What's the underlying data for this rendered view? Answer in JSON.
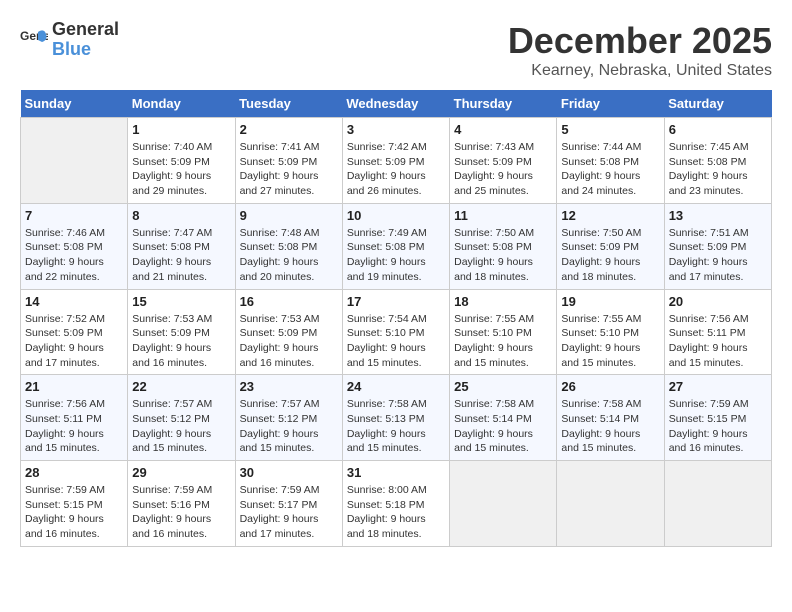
{
  "header": {
    "logo_general": "General",
    "logo_blue": "Blue",
    "month": "December 2025",
    "location": "Kearney, Nebraska, United States"
  },
  "days_of_week": [
    "Sunday",
    "Monday",
    "Tuesday",
    "Wednesday",
    "Thursday",
    "Friday",
    "Saturday"
  ],
  "weeks": [
    [
      {
        "day": "",
        "sunrise": "",
        "sunset": "",
        "daylight": ""
      },
      {
        "day": "1",
        "sunrise": "Sunrise: 7:40 AM",
        "sunset": "Sunset: 5:09 PM",
        "daylight": "Daylight: 9 hours and 29 minutes."
      },
      {
        "day": "2",
        "sunrise": "Sunrise: 7:41 AM",
        "sunset": "Sunset: 5:09 PM",
        "daylight": "Daylight: 9 hours and 27 minutes."
      },
      {
        "day": "3",
        "sunrise": "Sunrise: 7:42 AM",
        "sunset": "Sunset: 5:09 PM",
        "daylight": "Daylight: 9 hours and 26 minutes."
      },
      {
        "day": "4",
        "sunrise": "Sunrise: 7:43 AM",
        "sunset": "Sunset: 5:09 PM",
        "daylight": "Daylight: 9 hours and 25 minutes."
      },
      {
        "day": "5",
        "sunrise": "Sunrise: 7:44 AM",
        "sunset": "Sunset: 5:08 PM",
        "daylight": "Daylight: 9 hours and 24 minutes."
      },
      {
        "day": "6",
        "sunrise": "Sunrise: 7:45 AM",
        "sunset": "Sunset: 5:08 PM",
        "daylight": "Daylight: 9 hours and 23 minutes."
      }
    ],
    [
      {
        "day": "7",
        "sunrise": "Sunrise: 7:46 AM",
        "sunset": "Sunset: 5:08 PM",
        "daylight": "Daylight: 9 hours and 22 minutes."
      },
      {
        "day": "8",
        "sunrise": "Sunrise: 7:47 AM",
        "sunset": "Sunset: 5:08 PM",
        "daylight": "Daylight: 9 hours and 21 minutes."
      },
      {
        "day": "9",
        "sunrise": "Sunrise: 7:48 AM",
        "sunset": "Sunset: 5:08 PM",
        "daylight": "Daylight: 9 hours and 20 minutes."
      },
      {
        "day": "10",
        "sunrise": "Sunrise: 7:49 AM",
        "sunset": "Sunset: 5:08 PM",
        "daylight": "Daylight: 9 hours and 19 minutes."
      },
      {
        "day": "11",
        "sunrise": "Sunrise: 7:50 AM",
        "sunset": "Sunset: 5:08 PM",
        "daylight": "Daylight: 9 hours and 18 minutes."
      },
      {
        "day": "12",
        "sunrise": "Sunrise: 7:50 AM",
        "sunset": "Sunset: 5:09 PM",
        "daylight": "Daylight: 9 hours and 18 minutes."
      },
      {
        "day": "13",
        "sunrise": "Sunrise: 7:51 AM",
        "sunset": "Sunset: 5:09 PM",
        "daylight": "Daylight: 9 hours and 17 minutes."
      }
    ],
    [
      {
        "day": "14",
        "sunrise": "Sunrise: 7:52 AM",
        "sunset": "Sunset: 5:09 PM",
        "daylight": "Daylight: 9 hours and 17 minutes."
      },
      {
        "day": "15",
        "sunrise": "Sunrise: 7:53 AM",
        "sunset": "Sunset: 5:09 PM",
        "daylight": "Daylight: 9 hours and 16 minutes."
      },
      {
        "day": "16",
        "sunrise": "Sunrise: 7:53 AM",
        "sunset": "Sunset: 5:09 PM",
        "daylight": "Daylight: 9 hours and 16 minutes."
      },
      {
        "day": "17",
        "sunrise": "Sunrise: 7:54 AM",
        "sunset": "Sunset: 5:10 PM",
        "daylight": "Daylight: 9 hours and 15 minutes."
      },
      {
        "day": "18",
        "sunrise": "Sunrise: 7:55 AM",
        "sunset": "Sunset: 5:10 PM",
        "daylight": "Daylight: 9 hours and 15 minutes."
      },
      {
        "day": "19",
        "sunrise": "Sunrise: 7:55 AM",
        "sunset": "Sunset: 5:10 PM",
        "daylight": "Daylight: 9 hours and 15 minutes."
      },
      {
        "day": "20",
        "sunrise": "Sunrise: 7:56 AM",
        "sunset": "Sunset: 5:11 PM",
        "daylight": "Daylight: 9 hours and 15 minutes."
      }
    ],
    [
      {
        "day": "21",
        "sunrise": "Sunrise: 7:56 AM",
        "sunset": "Sunset: 5:11 PM",
        "daylight": "Daylight: 9 hours and 15 minutes."
      },
      {
        "day": "22",
        "sunrise": "Sunrise: 7:57 AM",
        "sunset": "Sunset: 5:12 PM",
        "daylight": "Daylight: 9 hours and 15 minutes."
      },
      {
        "day": "23",
        "sunrise": "Sunrise: 7:57 AM",
        "sunset": "Sunset: 5:12 PM",
        "daylight": "Daylight: 9 hours and 15 minutes."
      },
      {
        "day": "24",
        "sunrise": "Sunrise: 7:58 AM",
        "sunset": "Sunset: 5:13 PM",
        "daylight": "Daylight: 9 hours and 15 minutes."
      },
      {
        "day": "25",
        "sunrise": "Sunrise: 7:58 AM",
        "sunset": "Sunset: 5:14 PM",
        "daylight": "Daylight: 9 hours and 15 minutes."
      },
      {
        "day": "26",
        "sunrise": "Sunrise: 7:58 AM",
        "sunset": "Sunset: 5:14 PM",
        "daylight": "Daylight: 9 hours and 15 minutes."
      },
      {
        "day": "27",
        "sunrise": "Sunrise: 7:59 AM",
        "sunset": "Sunset: 5:15 PM",
        "daylight": "Daylight: 9 hours and 16 minutes."
      }
    ],
    [
      {
        "day": "28",
        "sunrise": "Sunrise: 7:59 AM",
        "sunset": "Sunset: 5:15 PM",
        "daylight": "Daylight: 9 hours and 16 minutes."
      },
      {
        "day": "29",
        "sunrise": "Sunrise: 7:59 AM",
        "sunset": "Sunset: 5:16 PM",
        "daylight": "Daylight: 9 hours and 16 minutes."
      },
      {
        "day": "30",
        "sunrise": "Sunrise: 7:59 AM",
        "sunset": "Sunset: 5:17 PM",
        "daylight": "Daylight: 9 hours and 17 minutes."
      },
      {
        "day": "31",
        "sunrise": "Sunrise: 8:00 AM",
        "sunset": "Sunset: 5:18 PM",
        "daylight": "Daylight: 9 hours and 18 minutes."
      },
      {
        "day": "",
        "sunrise": "",
        "sunset": "",
        "daylight": ""
      },
      {
        "day": "",
        "sunrise": "",
        "sunset": "",
        "daylight": ""
      },
      {
        "day": "",
        "sunrise": "",
        "sunset": "",
        "daylight": ""
      }
    ]
  ]
}
